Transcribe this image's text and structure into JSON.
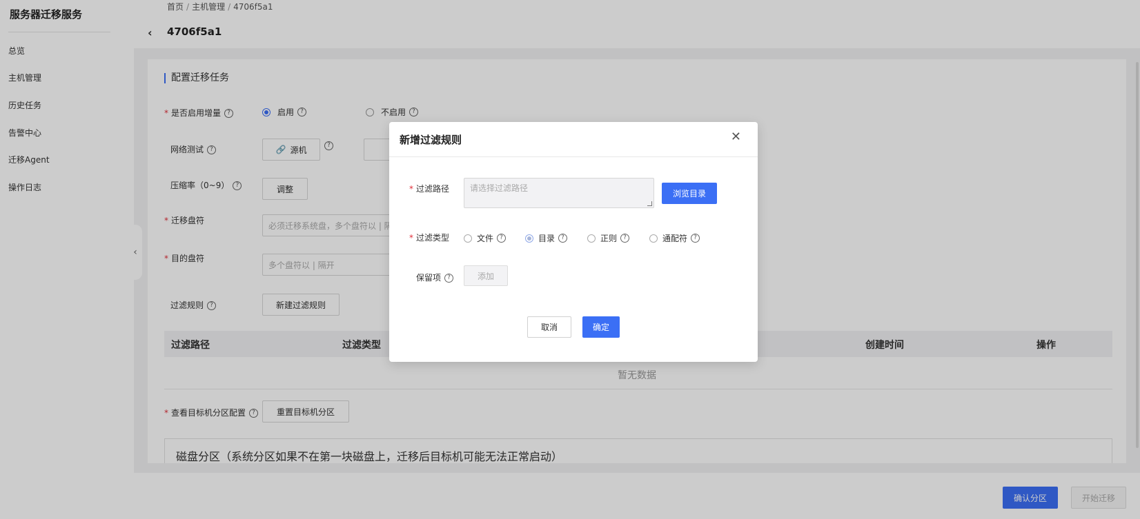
{
  "sidebar": {
    "title": "服务器迁移服务",
    "items": [
      {
        "label": "总览"
      },
      {
        "label": "主机管理"
      },
      {
        "label": "历史任务"
      },
      {
        "label": "告警中心"
      },
      {
        "label": "迁移Agent"
      },
      {
        "label": "操作日志"
      }
    ]
  },
  "breadcrumb": [
    "首页",
    "主机管理",
    "4706f5a1"
  ],
  "page": {
    "title": "4706f5a1"
  },
  "form": {
    "section_title": "配置迁移任务",
    "incremental_label": "是否启用增量",
    "enable_label": "启用",
    "disable_label": "不启用",
    "enable_selected": true,
    "network_test_label": "网络测试",
    "source_button": "源机",
    "compression_label": "压缩率（0~9）",
    "adjust_button": "调整",
    "migrate_drives_label": "迁移盘符",
    "migrate_drives_placeholder": "必须迁移系统盘，多个盘符以 | 隔",
    "target_drives_label": "目的盘符",
    "target_drives_placeholder": "多个盘符以 | 隔开",
    "filter_rules_label": "过滤规则",
    "new_filter_button": "新建过滤规则",
    "table_headers": [
      "过滤路径",
      "过滤类型",
      "创建时间",
      "操作"
    ],
    "empty_text": "暂无数据",
    "target_partition_label": "查看目标机分区配置",
    "reset_partition_button": "重置目标机分区",
    "partition_note": "磁盘分区（系统分区如果不在第一块磁盘上，迁移后目标机可能无法正常启动）"
  },
  "footer": {
    "confirm_partition": "确认分区",
    "start_migration": "开始迁移"
  },
  "modal": {
    "title": "新增过滤规则",
    "path_label": "过滤路径",
    "path_placeholder": "请选择过滤路径",
    "browse_button": "浏览目录",
    "type_label": "过滤类型",
    "types": [
      "文件",
      "目录",
      "正则",
      "通配符"
    ],
    "selected_type": "目录",
    "keep_label": "保留项",
    "add_button": "添加",
    "cancel_button": "取消",
    "ok_button": "确定"
  },
  "colors": {
    "primary": "#3b6ff5",
    "required": "#e0303a"
  }
}
